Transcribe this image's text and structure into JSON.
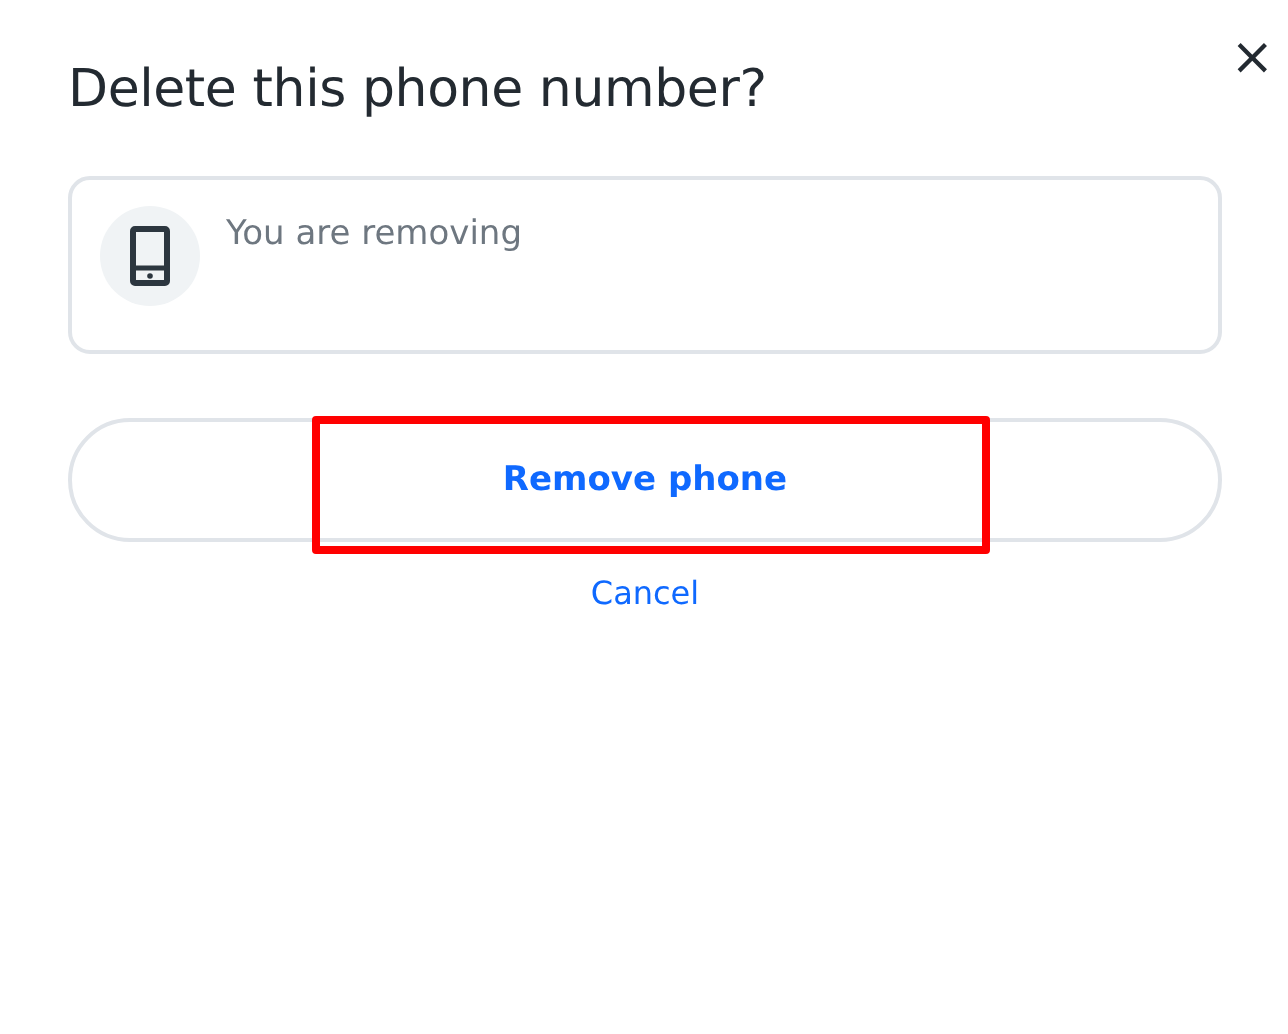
{
  "dialog": {
    "title": "Delete this phone number?",
    "close": "×"
  },
  "info_card": {
    "text": "You are removing"
  },
  "remove_button": {
    "label": "Remove phone",
    "highlighted": true
  },
  "cancel_link": {
    "label": "Cancel"
  }
}
